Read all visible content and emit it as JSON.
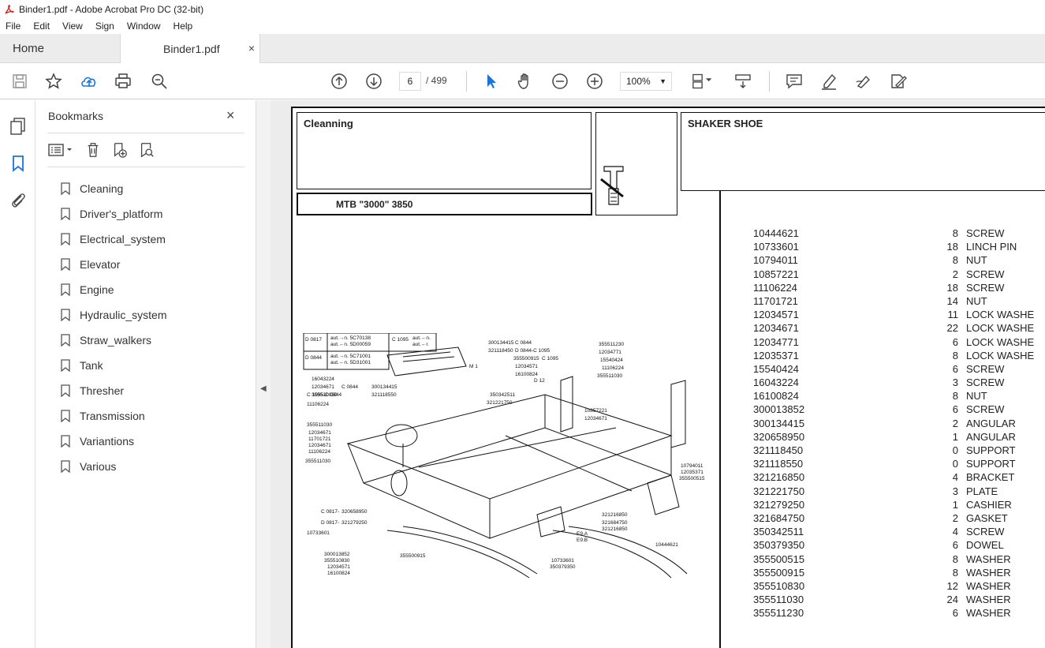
{
  "window": {
    "title": "Binder1.pdf - Adobe Acrobat Pro DC (32-bit)"
  },
  "menu": [
    "File",
    "Edit",
    "View",
    "Sign",
    "Window",
    "Help"
  ],
  "tabs": {
    "home": "Home",
    "doc": "Binder1.pdf",
    "close": "×"
  },
  "toolbar": {
    "page_current": "6",
    "page_total": "/ 499",
    "zoom": "100%"
  },
  "bookmarks": {
    "title": "Bookmarks",
    "close": "×",
    "items": [
      "Cleaning",
      "Driver's_platform",
      "Electrical_system",
      "Elevator",
      "Engine",
      "Hydraulic_system",
      "Straw_walkers",
      "Tank",
      "Thresher",
      "Transmission",
      "Variantions",
      "Various"
    ]
  },
  "doc": {
    "section": "Cleanning",
    "model": "MTB \"3000\" 3850",
    "heading": "SHAKER SHOE",
    "parts": [
      {
        "code": "10444621",
        "qty": "8",
        "desc": "SCREW"
      },
      {
        "code": "10733601",
        "qty": "18",
        "desc": "LINCH PIN"
      },
      {
        "code": "10794011",
        "qty": "8",
        "desc": "NUT"
      },
      {
        "code": "10857221",
        "qty": "2",
        "desc": "SCREW"
      },
      {
        "code": "11106224",
        "qty": "18",
        "desc": "SCREW"
      },
      {
        "code": "11701721",
        "qty": "14",
        "desc": "NUT"
      },
      {
        "code": "12034571",
        "qty": "11",
        "desc": "LOCK WASHE"
      },
      {
        "code": "12034671",
        "qty": "22",
        "desc": "LOCK WASHE"
      },
      {
        "code": "12034771",
        "qty": "6",
        "desc": "LOCK WASHE"
      },
      {
        "code": "12035371",
        "qty": "8",
        "desc": "LOCK WASHE"
      },
      {
        "code": "15540424",
        "qty": "6",
        "desc": "SCREW"
      },
      {
        "code": "16043224",
        "qty": "3",
        "desc": "SCREW"
      },
      {
        "code": "16100824",
        "qty": "8",
        "desc": "NUT"
      },
      {
        "code": "300013852",
        "qty": "6",
        "desc": "SCREW"
      },
      {
        "code": "300134415",
        "qty": "2",
        "desc": "ANGULAR"
      },
      {
        "code": "320658950",
        "qty": "1",
        "desc": "ANGULAR"
      },
      {
        "code": "321118450",
        "qty": "0",
        "desc": "SUPPORT"
      },
      {
        "code": "321118550",
        "qty": "0",
        "desc": "SUPPORT"
      },
      {
        "code": "321216850",
        "qty": "4",
        "desc": "BRACKET"
      },
      {
        "code": "321221750",
        "qty": "3",
        "desc": "PLATE"
      },
      {
        "code": "321279250",
        "qty": "1",
        "desc": "CASHIER"
      },
      {
        "code": "321684750",
        "qty": "2",
        "desc": "GASKET"
      },
      {
        "code": "350342511",
        "qty": "4",
        "desc": "SCREW"
      },
      {
        "code": "350379350",
        "qty": "6",
        "desc": "DOWEL"
      },
      {
        "code": "355500515",
        "qty": "8",
        "desc": "WASHER"
      },
      {
        "code": "355500915",
        "qty": "8",
        "desc": "WASHER"
      },
      {
        "code": "355510830",
        "qty": "12",
        "desc": "WASHER"
      },
      {
        "code": "355511030",
        "qty": "24",
        "desc": "WASHER"
      },
      {
        "code": "355511230",
        "qty": "6",
        "desc": "WASHER"
      }
    ],
    "diagram_labels": [
      "D 0817",
      "aut.→n. 5C70138",
      "aut.←n. 5D00059",
      "C 1095",
      "aut.←n.",
      "aut.←r.",
      "D 0844",
      "aut.→n. 5C71001",
      "aut.←n. 5D31001",
      "16043224",
      "12034671",
      "355510830",
      "300134415",
      "C 0844",
      "321118450",
      "D 0844-C 1095",
      "355500915",
      "C 1095",
      "12034571",
      "16100824",
      "M 1",
      "D 12",
      "355511230",
      "12034771",
      "15540424",
      "11106224",
      "355511030",
      "C 0844",
      "300134415",
      "C 1095-D 0844",
      "321118550",
      "11106224",
      "350342511",
      "321221750",
      "10857221",
      "12034671",
      "355511030",
      "12034671",
      "11701721",
      "12034671",
      "11106224",
      "355511030",
      "10794011",
      "12035371",
      "355500515",
      "C 0817-",
      "320658950",
      "D 0817-",
      "321279250",
      "10733601",
      "321216850",
      "321684750",
      "321216850",
      "E9.A",
      "E9.B",
      "10444621",
      "300013852",
      "355510830",
      "12034571",
      "16100824",
      "355500915",
      "10733601",
      "350379350"
    ]
  }
}
